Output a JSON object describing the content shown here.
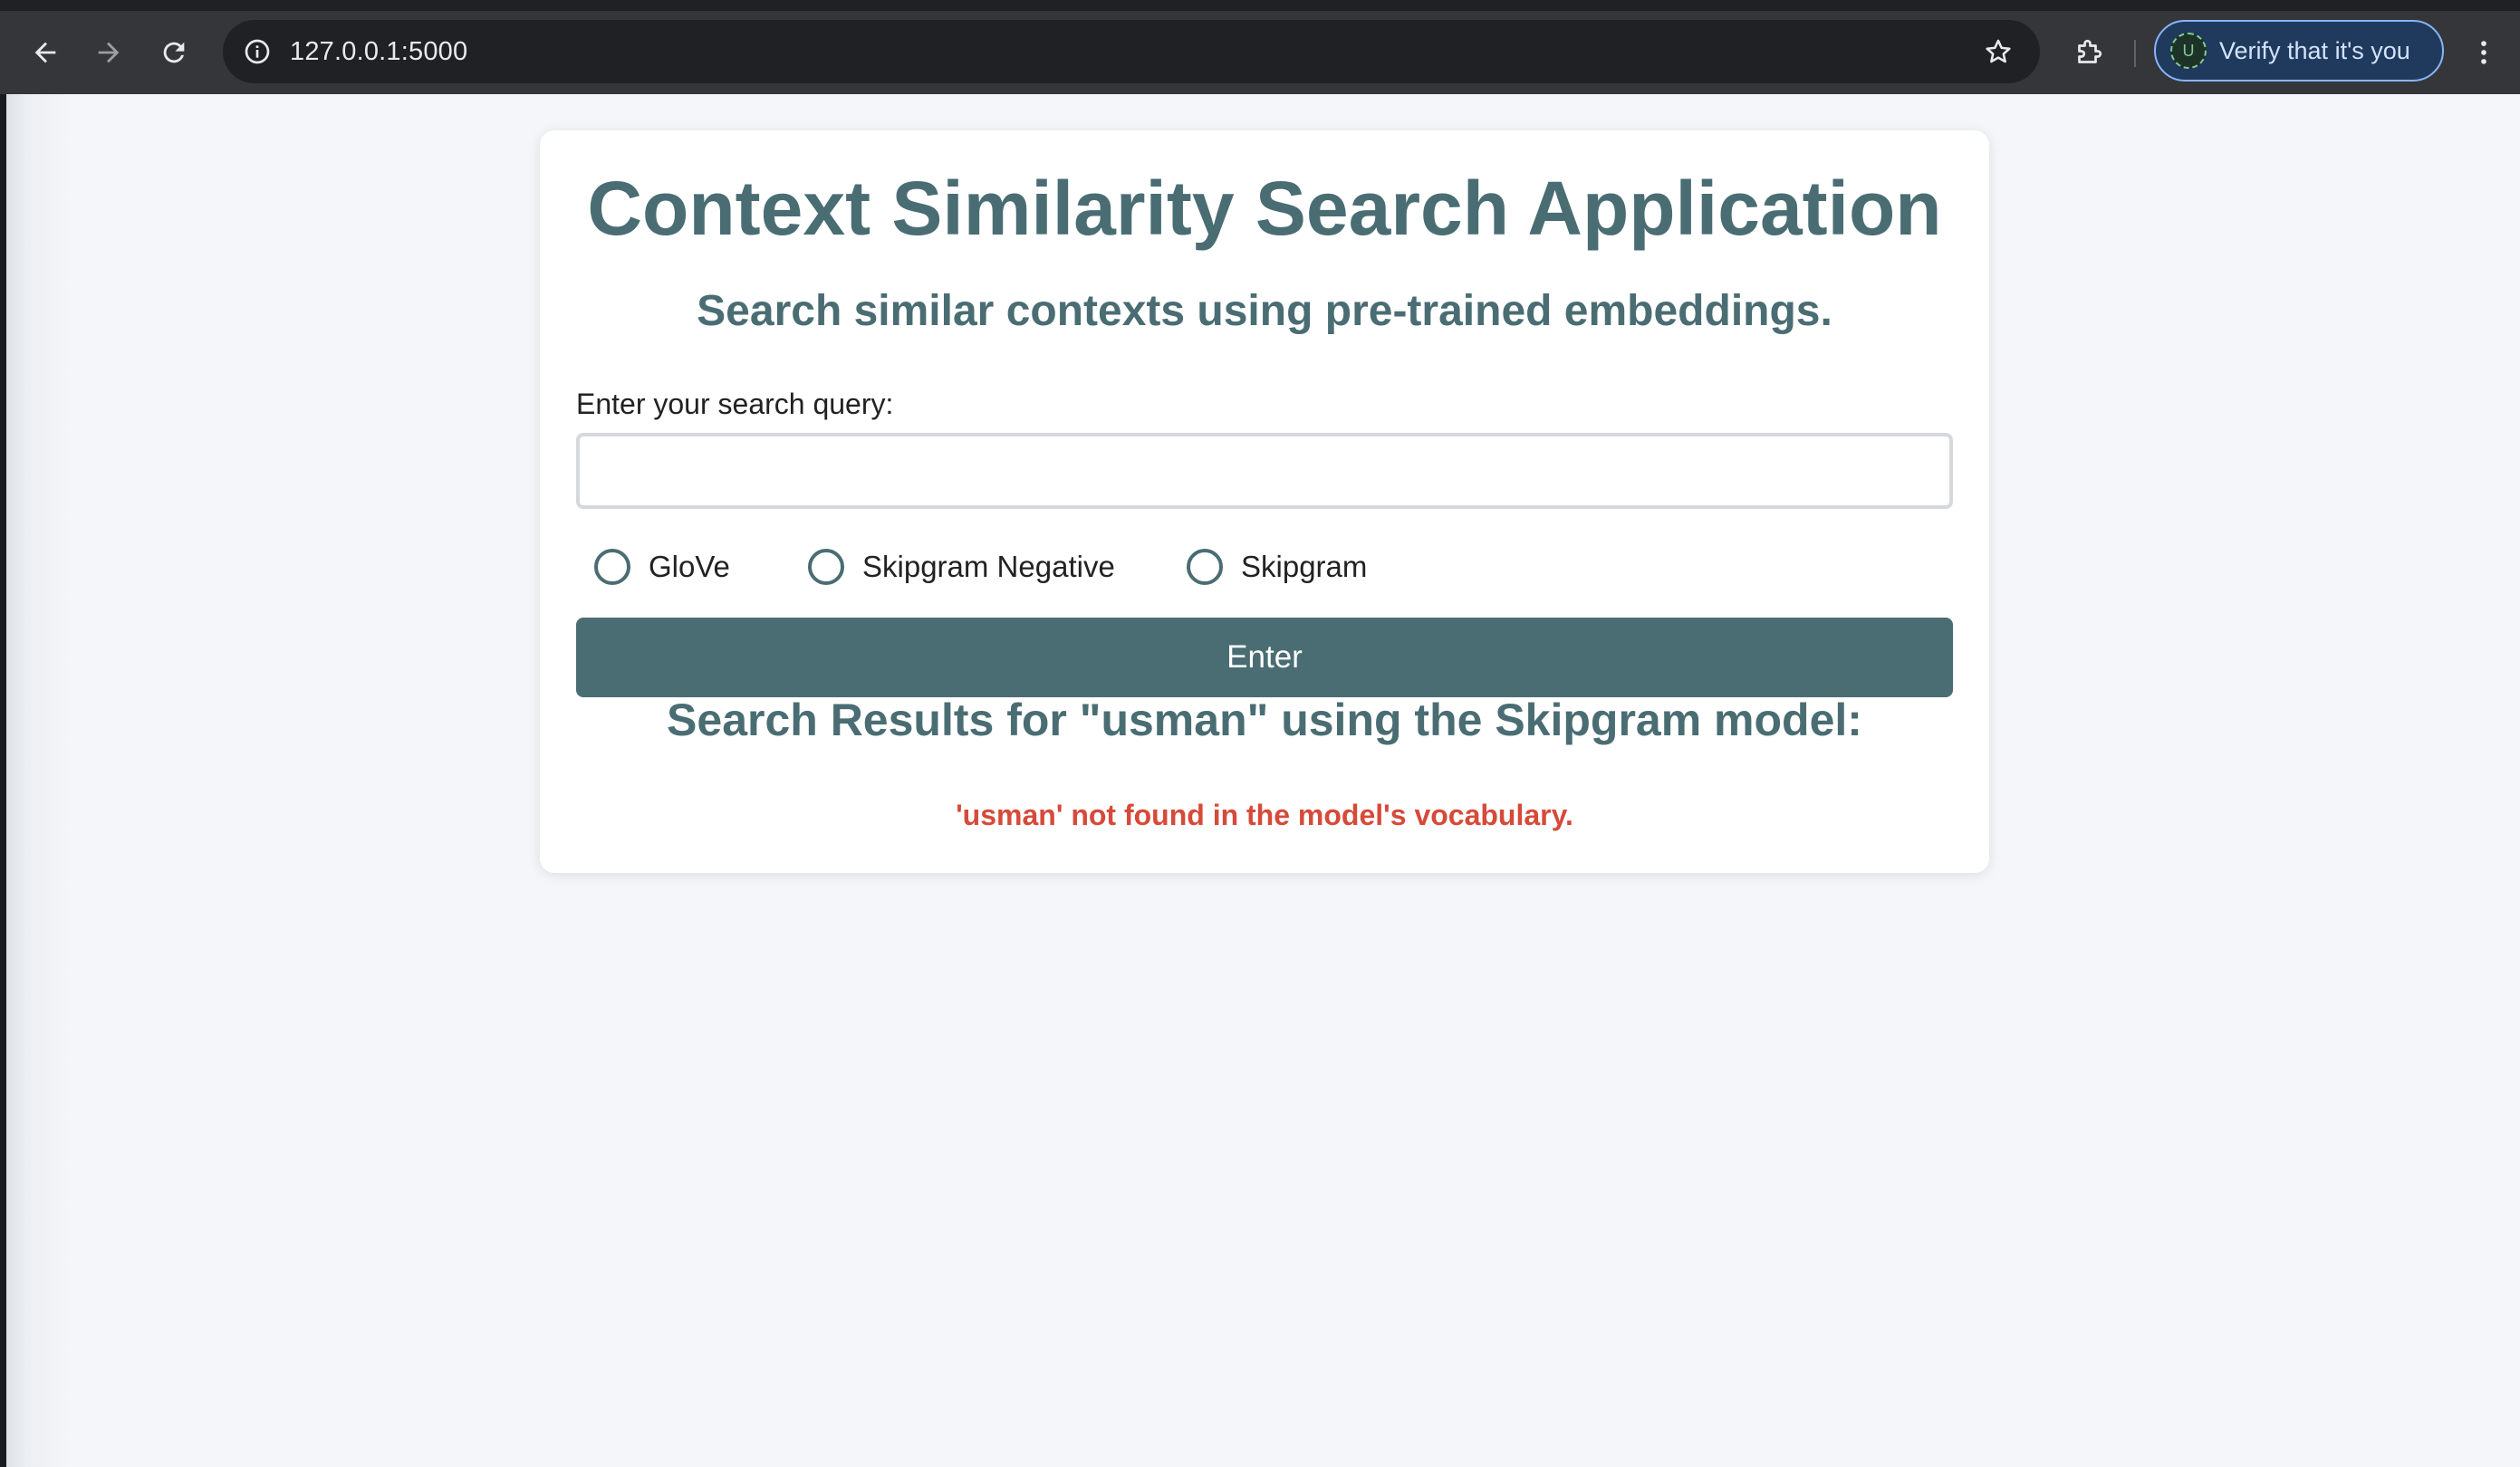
{
  "browser": {
    "url": "127.0.0.1:5000",
    "profile_chip": {
      "avatar_letter": "U",
      "label": "Verify that it's you"
    },
    "icons": {
      "back": "arrow-left-icon",
      "forward": "arrow-right-icon",
      "reload": "reload-icon",
      "site_info": "info-icon",
      "bookmark": "star-icon",
      "extensions": "puzzle-icon",
      "menu": "kebab-menu-icon"
    }
  },
  "page": {
    "title": "Context Similarity Search Application",
    "subtitle": "Search similar contexts using pre-trained embeddings.",
    "query_label": "Enter your search query:",
    "query_value": "",
    "models": [
      {
        "label": "GloVe",
        "selected": false
      },
      {
        "label": "Skipgram Negative",
        "selected": false
      },
      {
        "label": "Skipgram",
        "selected": false
      }
    ],
    "enter_label": "Enter",
    "results_title": "Search Results for \"usman\" using the Skipgram model:",
    "error_message": "'usman' not found in the model's vocabulary."
  },
  "colors": {
    "accent": "#4a6d73",
    "error": "#d64a3a",
    "page_background": "#f4f6f9"
  }
}
